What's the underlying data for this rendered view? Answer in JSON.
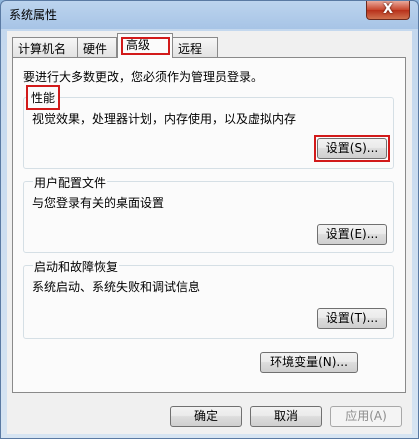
{
  "window": {
    "title": "系统属性",
    "close_glyph": "X"
  },
  "tabs": [
    {
      "label": "计算机名",
      "active": false
    },
    {
      "label": "硬件",
      "active": false
    },
    {
      "label": "高级",
      "active": true
    },
    {
      "label": "远程",
      "active": false
    }
  ],
  "notice": "要进行大多数更改，您必须作为管理员登录。",
  "groups": {
    "performance": {
      "title": "性能",
      "description": "视觉效果，处理器计划，内存使用，以及虚拟内存",
      "button": "设置(S)..."
    },
    "user_profiles": {
      "title": "用户配置文件",
      "description": "与您登录有关的桌面设置",
      "button": "设置(E)..."
    },
    "startup_recovery": {
      "title": "启动和故障恢复",
      "description": "系统启动、系统失败和调试信息",
      "button": "设置(T)..."
    }
  },
  "env_button": "环境变量(N)...",
  "footer": {
    "ok": "确定",
    "cancel": "取消",
    "apply": "应用(A)"
  },
  "highlight_color": "#d21a1a"
}
